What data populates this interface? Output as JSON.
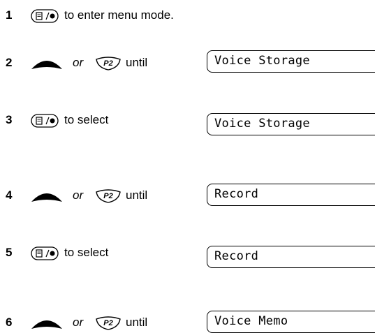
{
  "steps": [
    {
      "number": "1",
      "icon": "menu-select-key",
      "text": "to enter menu mode.",
      "or": "",
      "until": "",
      "display": ""
    },
    {
      "number": "2",
      "icon": "scroll-key",
      "text": "",
      "or": "or",
      "until": "until",
      "display": "Voice Storage"
    },
    {
      "number": "3",
      "icon": "menu-select-key",
      "text": "to select",
      "or": "",
      "until": "",
      "display": "Voice Storage"
    },
    {
      "number": "4",
      "icon": "scroll-key",
      "text": "",
      "or": "or",
      "until": "until",
      "display": "Record"
    },
    {
      "number": "5",
      "icon": "menu-select-key",
      "text": "to select",
      "or": "",
      "until": "",
      "display": "Record"
    },
    {
      "number": "6",
      "icon": "scroll-key",
      "text": "",
      "or": "or",
      "until": "until",
      "display": "Voice Memo"
    }
  ],
  "p2_key_label": "P2"
}
